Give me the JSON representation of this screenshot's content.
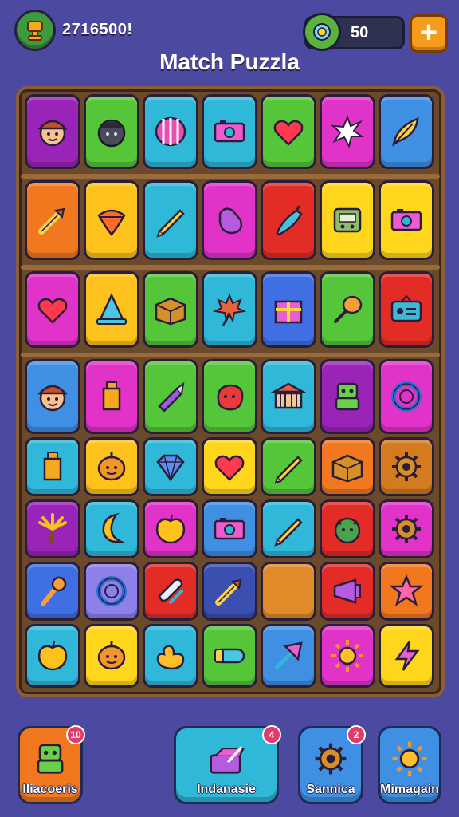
{
  "header": {
    "score_text": "2716500!",
    "coin_value": "50",
    "plus_label": "+",
    "title": "Match Puzzla"
  },
  "colors": {
    "background": "#4b4aa0",
    "board": "#6b4a2c",
    "accent_orange": "#f59b1d"
  },
  "board_rows": [
    [
      {
        "color": "#9a24b8",
        "icon": "face-icon"
      },
      {
        "color": "#55c63a",
        "icon": "dark-face-icon"
      },
      {
        "color": "#2fb8d8",
        "icon": "striped-ball-icon"
      },
      {
        "color": "#2fb8d8",
        "icon": "camera-icon"
      },
      {
        "color": "#55c63a",
        "icon": "heart-icon"
      },
      {
        "color": "#e233c9",
        "icon": "splash-icon"
      },
      {
        "color": "#3f8fe3",
        "icon": "leaf-icon"
      }
    ],
    [
      {
        "color": "#f2781f",
        "icon": "dropper-icon"
      },
      {
        "color": "#ffc21c",
        "icon": "spinning-top-icon"
      },
      {
        "color": "#2fb8d8",
        "icon": "pencil-icon"
      },
      {
        "color": "#e233c9",
        "icon": "mitten-icon"
      },
      {
        "color": "#e22c25",
        "icon": "pepper-icon"
      },
      {
        "color": "#ffd61c",
        "icon": "robot-box-icon"
      },
      {
        "color": "#ffd61c",
        "icon": "camera-icon"
      }
    ],
    [
      {
        "color": "#e233c9",
        "icon": "heart-icon"
      },
      {
        "color": "#ffc21c",
        "icon": "cone-icon"
      },
      {
        "color": "#55c63a",
        "icon": "box-icon"
      },
      {
        "color": "#2fb8d8",
        "icon": "maple-leaf-icon"
      },
      {
        "color": "#3f6fe3",
        "icon": "gift-box-icon"
      },
      {
        "color": "#55c63a",
        "icon": "racket-icon"
      },
      {
        "color": "#e22c25",
        "icon": "radio-icon"
      }
    ],
    [
      {
        "color": "#3f8fe3",
        "icon": "face-icon"
      },
      {
        "color": "#e233c9",
        "icon": "bottle-icon"
      },
      {
        "color": "#55c63a",
        "icon": "crayon-icon"
      },
      {
        "color": "#55c63a",
        "icon": "blob-icon"
      },
      {
        "color": "#2fb8d8",
        "icon": "temple-icon"
      },
      {
        "color": "#9a24b8",
        "icon": "robot-icon"
      },
      {
        "color": "#e233c9",
        "icon": "ring-icon"
      }
    ],
    [
      {
        "color": "#2fb8d8",
        "icon": "bottle-icon"
      },
      {
        "color": "#ffc21c",
        "icon": "pumpkin-icon"
      },
      {
        "color": "#2fb8d8",
        "icon": "gem-icon"
      },
      {
        "color": "#ffd61c",
        "icon": "heart-icon"
      },
      {
        "color": "#55c63a",
        "icon": "pencil-icon"
      },
      {
        "color": "#f2781f",
        "icon": "box-icon"
      },
      {
        "color": "#d47a1f",
        "icon": "gear-icon"
      }
    ],
    [
      {
        "color": "#9a24b8",
        "icon": "palm-icon"
      },
      {
        "color": "#2fb8d8",
        "icon": "moon-icon"
      },
      {
        "color": "#e233c9",
        "icon": "apple-icon"
      },
      {
        "color": "#3f8fe3",
        "icon": "camera-icon"
      },
      {
        "color": "#2fb8d8",
        "icon": "pencil-icon"
      },
      {
        "color": "#e22c25",
        "icon": "monster-icon"
      },
      {
        "color": "#e233c9",
        "icon": "gear-icon"
      }
    ],
    [
      {
        "color": "#3f6fe3",
        "icon": "torch-icon"
      },
      {
        "color": "#8f7fe8",
        "icon": "ring-icon"
      },
      {
        "color": "#e22c25",
        "icon": "clip-icon"
      },
      {
        "color": "#3a4fb0",
        "icon": "dropper-icon"
      },
      {
        "color": "#e08a2a",
        "icon": "empty-icon"
      },
      {
        "color": "#e22c25",
        "icon": "megaphone-icon"
      },
      {
        "color": "#f2781f",
        "icon": "star-icon"
      }
    ],
    [
      {
        "color": "#2fb8d8",
        "icon": "apple-icon"
      },
      {
        "color": "#ffd61c",
        "icon": "pumpkin-icon"
      },
      {
        "color": "#2fb8d8",
        "icon": "duck-icon"
      },
      {
        "color": "#55c63a",
        "icon": "tube-icon"
      },
      {
        "color": "#3f8fe3",
        "icon": "arrow-icon"
      },
      {
        "color": "#e233c9",
        "icon": "sun-icon"
      },
      {
        "color": "#ffd61c",
        "icon": "lightning-icon"
      }
    ]
  ],
  "bottom_bar": [
    {
      "label": "Iliacoeris",
      "badge": "10",
      "color": "#f2781f",
      "icon": "robot-icon"
    },
    {
      "label": "Indanasie",
      "badge": "4",
      "color": "#2fb8d8",
      "icon": "wand-box-icon"
    },
    {
      "label": "Sannica",
      "badge": "2",
      "color": "#3f8fe3",
      "icon": "gear-icon"
    },
    {
      "label": "Mimagain",
      "badge": "",
      "color": "#3f8fe3",
      "icon": "sun-icon"
    }
  ]
}
